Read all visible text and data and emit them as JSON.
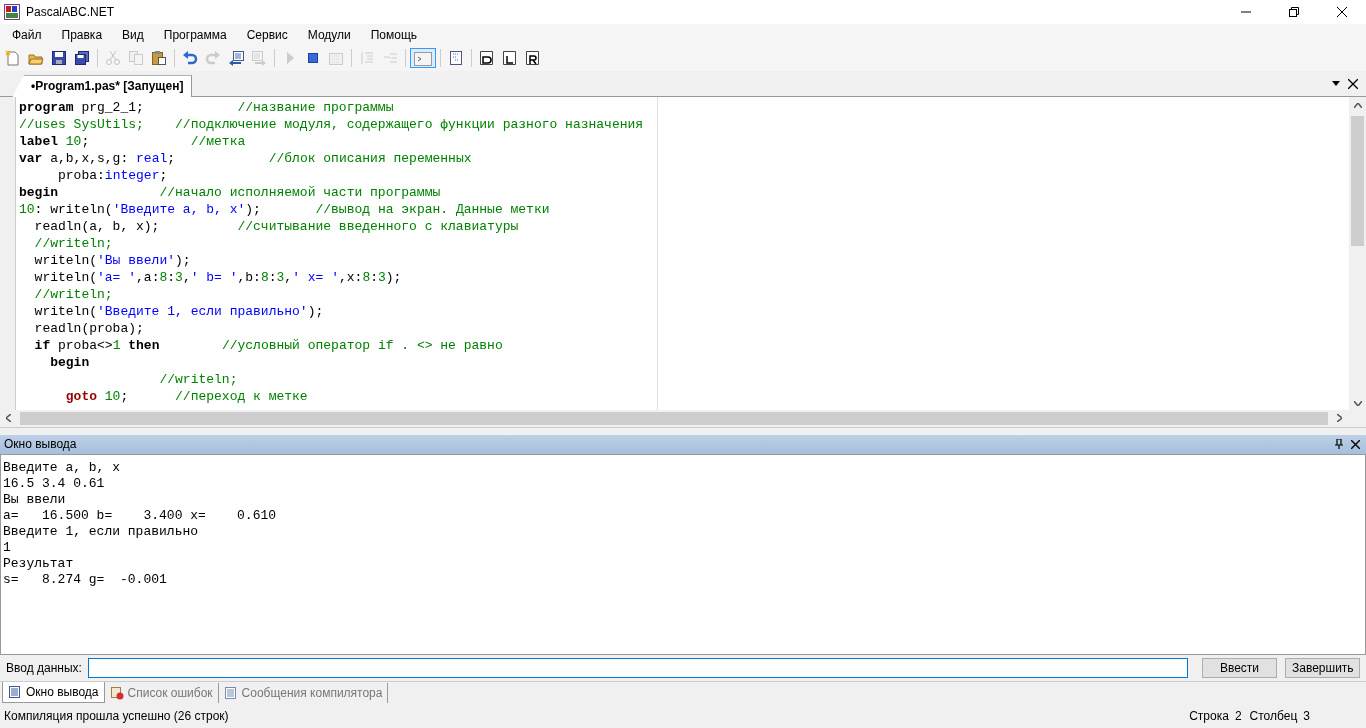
{
  "window": {
    "title": "PascalABC.NET"
  },
  "menu": [
    "Файл",
    "Правка",
    "Вид",
    "Программа",
    "Сервис",
    "Модули",
    "Помощь"
  ],
  "toolbar": [
    {
      "kind": "new",
      "disabled": false,
      "selected": false
    },
    {
      "kind": "open",
      "disabled": false,
      "selected": false
    },
    {
      "kind": "save",
      "disabled": false,
      "selected": false
    },
    {
      "kind": "saveall",
      "disabled": false,
      "selected": false
    },
    {
      "kind": "sep"
    },
    {
      "kind": "cut",
      "disabled": true,
      "selected": false
    },
    {
      "kind": "copy",
      "disabled": true,
      "selected": false
    },
    {
      "kind": "paste",
      "disabled": false,
      "selected": false
    },
    {
      "kind": "sep"
    },
    {
      "kind": "undo",
      "disabled": false,
      "selected": false
    },
    {
      "kind": "redo",
      "disabled": true,
      "selected": false
    },
    {
      "kind": "back",
      "disabled": false,
      "selected": false
    },
    {
      "kind": "forward",
      "disabled": true,
      "selected": false
    },
    {
      "kind": "sep"
    },
    {
      "kind": "run",
      "disabled": true,
      "selected": false
    },
    {
      "kind": "stop",
      "disabled": false,
      "selected": false
    },
    {
      "kind": "compile",
      "disabled": true,
      "selected": false
    },
    {
      "kind": "sep"
    },
    {
      "kind": "stepin",
      "disabled": true,
      "selected": false
    },
    {
      "kind": "stepover",
      "disabled": true,
      "selected": false
    },
    {
      "kind": "sep"
    },
    {
      "kind": "console",
      "disabled": false,
      "selected": true
    },
    {
      "kind": "sep"
    },
    {
      "kind": "list",
      "disabled": false,
      "selected": false
    },
    {
      "kind": "sep"
    },
    {
      "kind": "docD",
      "disabled": false,
      "selected": false
    },
    {
      "kind": "docL",
      "disabled": false,
      "selected": false
    },
    {
      "kind": "docR",
      "disabled": false,
      "selected": false
    }
  ],
  "editor_tab": {
    "label": "•Program1.pas* [Запущен]",
    "selected": true
  },
  "code_lines": [
    [
      {
        "kind": "kw",
        "text": "program"
      },
      {
        "kind": "plain",
        "text": " prg_2_1;            "
      },
      {
        "kind": "comment",
        "text": "//название программы"
      }
    ],
    [
      {
        "kind": "comment",
        "text": "//uses SysUtils;    //подключение модуля, содержащего функции разного назначения"
      }
    ],
    [
      {
        "kind": "kw",
        "text": "label"
      },
      {
        "kind": "num",
        "text": " 10"
      },
      {
        "kind": "plain",
        "text": ";             "
      },
      {
        "kind": "comment",
        "text": "//метка"
      }
    ],
    [
      {
        "kind": "kw",
        "text": "var"
      },
      {
        "kind": "plain",
        "text": " a,b,x,s,g: "
      },
      {
        "kind": "type",
        "text": "real"
      },
      {
        "kind": "plain",
        "text": ";            "
      },
      {
        "kind": "comment",
        "text": "//блок описания переменных"
      }
    ],
    [
      {
        "kind": "plain",
        "text": "     proba:"
      },
      {
        "kind": "type",
        "text": "integer"
      },
      {
        "kind": "plain",
        "text": ";"
      }
    ],
    [
      {
        "kind": "kw",
        "text": "begin"
      },
      {
        "kind": "comment",
        "text": "             //начало исполняемой части программы"
      }
    ],
    [
      {
        "kind": "num",
        "text": "10"
      },
      {
        "kind": "plain",
        "text": ": writeln("
      },
      {
        "kind": "str",
        "text": "'Введите a, b, x'"
      },
      {
        "kind": "plain",
        "text": ");       "
      },
      {
        "kind": "comment",
        "text": "//вывод на экран. Данные метки"
      }
    ],
    [
      {
        "kind": "plain",
        "text": "  readln(a, b, x);          "
      },
      {
        "kind": "comment",
        "text": "//считывание введенного с клавиатуры"
      }
    ],
    [
      {
        "kind": "comment",
        "text": "  //writeln;"
      }
    ],
    [
      {
        "kind": "plain",
        "text": "  writeln("
      },
      {
        "kind": "str",
        "text": "'Вы ввели'"
      },
      {
        "kind": "plain",
        "text": ");"
      }
    ],
    [
      {
        "kind": "plain",
        "text": "  writeln("
      },
      {
        "kind": "str",
        "text": "'a= '"
      },
      {
        "kind": "plain",
        "text": ",a:"
      },
      {
        "kind": "num",
        "text": "8"
      },
      {
        "kind": "plain",
        "text": ":"
      },
      {
        "kind": "num",
        "text": "3"
      },
      {
        "kind": "plain",
        "text": ","
      },
      {
        "kind": "str",
        "text": "' b= '"
      },
      {
        "kind": "plain",
        "text": ",b:"
      },
      {
        "kind": "num",
        "text": "8"
      },
      {
        "kind": "plain",
        "text": ":"
      },
      {
        "kind": "num",
        "text": "3"
      },
      {
        "kind": "plain",
        "text": ","
      },
      {
        "kind": "str",
        "text": "' x= '"
      },
      {
        "kind": "plain",
        "text": ",x:"
      },
      {
        "kind": "num",
        "text": "8"
      },
      {
        "kind": "plain",
        "text": ":"
      },
      {
        "kind": "num",
        "text": "3"
      },
      {
        "kind": "plain",
        "text": ");"
      }
    ],
    [
      {
        "kind": "comment",
        "text": "  //writeln;"
      }
    ],
    [
      {
        "kind": "plain",
        "text": "  writeln("
      },
      {
        "kind": "str",
        "text": "'Введите 1, если правильно'"
      },
      {
        "kind": "plain",
        "text": ");"
      }
    ],
    [
      {
        "kind": "plain",
        "text": "  readln(proba);"
      }
    ],
    [
      {
        "kind": "kw",
        "text": "  if"
      },
      {
        "kind": "plain",
        "text": " proba<>"
      },
      {
        "kind": "num",
        "text": "1"
      },
      {
        "kind": "kw",
        "text": " then"
      },
      {
        "kind": "comment",
        "text": "        //условный оператор if . <> не равно"
      }
    ],
    [
      {
        "kind": "kw",
        "text": "    begin"
      }
    ],
    [
      {
        "kind": "comment",
        "text": "                  //writeln;"
      }
    ],
    [
      {
        "kind": "goto",
        "text": "      goto"
      },
      {
        "kind": "num",
        "text": " 10"
      },
      {
        "kind": "plain",
        "text": ";      "
      },
      {
        "kind": "comment",
        "text": "//переход к метке"
      }
    ]
  ],
  "output_panel": {
    "title": "Окно вывода",
    "lines": [
      "Введите a, b, x",
      "16.5 3.4 0.61",
      "Вы ввели",
      "a=   16.500 b=    3.400 x=    0.610",
      "Введите 1, если правильно",
      "1",
      "Результат",
      "s=   8.274 g=  -0.001"
    ]
  },
  "input_bar": {
    "label": "Ввод данных:",
    "buttons": [
      "Ввести",
      "Завершить"
    ]
  },
  "bottom_tabs": [
    {
      "label": "Окно вывода",
      "selected": true
    },
    {
      "label": "Список ошибок",
      "selected": false
    },
    {
      "label": "Сообщения компилятора",
      "selected": false
    }
  ],
  "status_bar": {
    "message": "Компиляция прошла успешно (26 строк)",
    "row_label": "Строка",
    "row": "2",
    "column_label": "Столбец",
    "column": "3"
  }
}
